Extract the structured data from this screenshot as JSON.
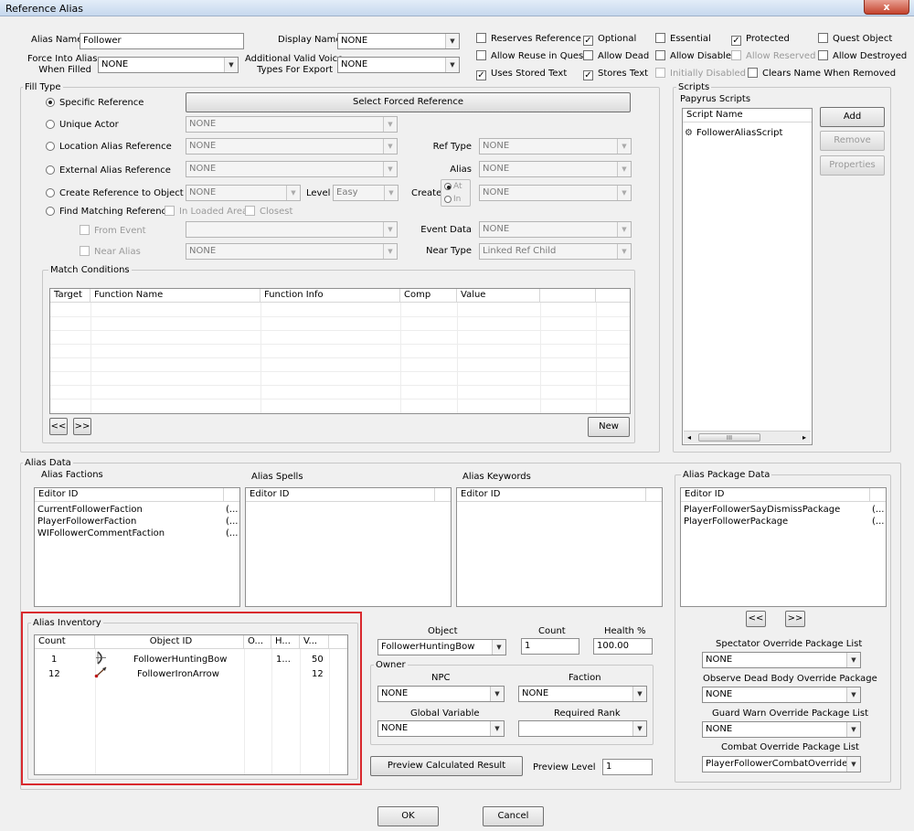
{
  "window": {
    "title": "Reference Alias",
    "close_glyph": "x"
  },
  "top": {
    "alias_name_label": "Alias Name",
    "alias_name_value": "Follower",
    "display_name_label": "Display Name",
    "display_name_value": "NONE",
    "force_into_alias_label_1": "Force Into Alias",
    "force_into_alias_label_2": "When Filled",
    "force_into_alias_value": "NONE",
    "voice_types_label_1": "Additional Valid Voice",
    "voice_types_label_2": "Types For Export",
    "voice_types_value": "NONE",
    "flags": {
      "reserves_reference": {
        "label": "Reserves Reference",
        "checked": false
      },
      "allow_reuse": {
        "label": "Allow Reuse in Quest",
        "checked": false
      },
      "uses_stored_text": {
        "label": "Uses Stored Text",
        "checked": true
      },
      "optional": {
        "label": "Optional",
        "checked": true
      },
      "allow_dead": {
        "label": "Allow Dead",
        "checked": false
      },
      "stores_text": {
        "label": "Stores Text",
        "checked": true
      },
      "essential": {
        "label": "Essential",
        "checked": false
      },
      "allow_disabled": {
        "label": "Allow Disabled",
        "checked": false
      },
      "initially_disabled": {
        "label": "Initially Disabled",
        "checked": false
      },
      "protected": {
        "label": "Protected",
        "checked": true
      },
      "allow_reserved": {
        "label": "Allow Reserved",
        "checked": false
      },
      "clears_name": {
        "label": "Clears Name When Removed",
        "checked": false
      },
      "quest_object": {
        "label": "Quest Object",
        "checked": false
      },
      "allow_destroyed": {
        "label": "Allow Destroyed",
        "checked": false
      }
    }
  },
  "fill_type": {
    "group_label": "Fill Type",
    "specific_reference": "Specific Reference",
    "select_forced_reference": "Select Forced Reference",
    "unique_actor": "Unique Actor",
    "unique_actor_value": "NONE",
    "location_alias_reference": "Location Alias Reference",
    "location_alias_value": "NONE",
    "ref_type_label": "Ref Type",
    "ref_type_value": "NONE",
    "external_alias_reference": "External Alias Reference",
    "external_alias_value": "NONE",
    "alias_label": "Alias",
    "alias_value": "NONE",
    "create_reference_to_object": "Create Reference to Object",
    "create_object_value": "NONE",
    "level_label": "Level",
    "level_value": "Easy",
    "create_label": "Create",
    "at_label": "At",
    "in_label": "In",
    "create_value": "NONE",
    "find_matching_reference": "Find Matching Reference",
    "in_loaded_area": "In Loaded Area",
    "closest": "Closest",
    "from_event": "From Event",
    "from_event_value": "",
    "event_data_label": "Event Data",
    "event_data_value": "NONE",
    "near_alias": "Near Alias",
    "near_alias_value": "NONE",
    "near_type_label": "Near Type",
    "near_type_value": "Linked Ref Child",
    "match_conditions_label": "Match Conditions",
    "columns": [
      "Target",
      "Function Name",
      "Function Info",
      "Comp",
      "Value",
      ""
    ],
    "prev_page": "<<",
    "next_page": ">>",
    "new_button": "New"
  },
  "scripts": {
    "group_label": "Scripts",
    "papyrus_label": "Papyrus Scripts",
    "column": "Script Name",
    "items": [
      "FollowerAliasScript"
    ],
    "add": "Add",
    "remove": "Remove",
    "properties": "Properties",
    "scroll_left": "◂",
    "scroll_grip": "III",
    "scroll_right": "▸"
  },
  "alias_data": {
    "group_label": "Alias Data",
    "factions": {
      "label": "Alias Factions",
      "column": "Editor ID",
      "rows": [
        {
          "id": "CurrentFollowerFaction",
          "extra": "(..."
        },
        {
          "id": "PlayerFollowerFaction",
          "extra": "(..."
        },
        {
          "id": "WIFollowerCommentFaction",
          "extra": "(..."
        }
      ]
    },
    "spells": {
      "label": "Alias Spells",
      "column": "Editor ID"
    },
    "keywords": {
      "label": "Alias Keywords",
      "column": "Editor ID"
    },
    "packages": {
      "label": "Alias Package Data",
      "column": "Editor ID",
      "rows": [
        {
          "id": "PlayerFollowerSayDismissPackage",
          "extra": "(..."
        },
        {
          "id": "PlayerFollowerPackage",
          "extra": "(..."
        }
      ]
    },
    "pkg_prev": "<<",
    "pkg_next": ">>"
  },
  "inventory": {
    "label": "Alias Inventory",
    "columns": [
      "Count",
      "Object ID",
      "O...",
      "H...",
      "V..."
    ],
    "rows": [
      {
        "count": "1",
        "object": "FollowerHuntingBow",
        "o": "",
        "h": "1...",
        "v": "50",
        "icon": "bow-icon"
      },
      {
        "count": "12",
        "object": "FollowerIronArrow",
        "o": "",
        "h": "",
        "v": "12",
        "icon": "arrow-icon"
      }
    ]
  },
  "object_panel": {
    "object_label": "Object",
    "object_value": "FollowerHuntingBow",
    "count_label": "Count",
    "count_value": "1",
    "health_label": "Health %",
    "health_value": "100.00",
    "owner_label": "Owner",
    "npc_label": "NPC",
    "npc_value": "NONE",
    "faction_label": "Faction",
    "faction_value": "NONE",
    "global_variable_label": "Global Variable",
    "global_variable_value": "NONE",
    "required_rank_label": "Required Rank",
    "required_rank_value": "",
    "preview_button": "Preview Calculated Result",
    "preview_level_label": "Preview Level",
    "preview_level_value": "1"
  },
  "overrides": {
    "spectator_label": "Spectator Override Package List",
    "spectator_value": "NONE",
    "observe_label": "Observe Dead Body Override Package",
    "observe_value": "NONE",
    "guard_label": "Guard Warn Override Package List",
    "guard_value": "NONE",
    "combat_label": "Combat Override Package List",
    "combat_value": "PlayerFollowerCombatOverridePac"
  },
  "footer": {
    "ok": "OK",
    "cancel": "Cancel"
  },
  "colors": {
    "highlight": "#d9282d",
    "title_bar": "#c6d8ee",
    "window_bg": "#f0f0f0"
  }
}
